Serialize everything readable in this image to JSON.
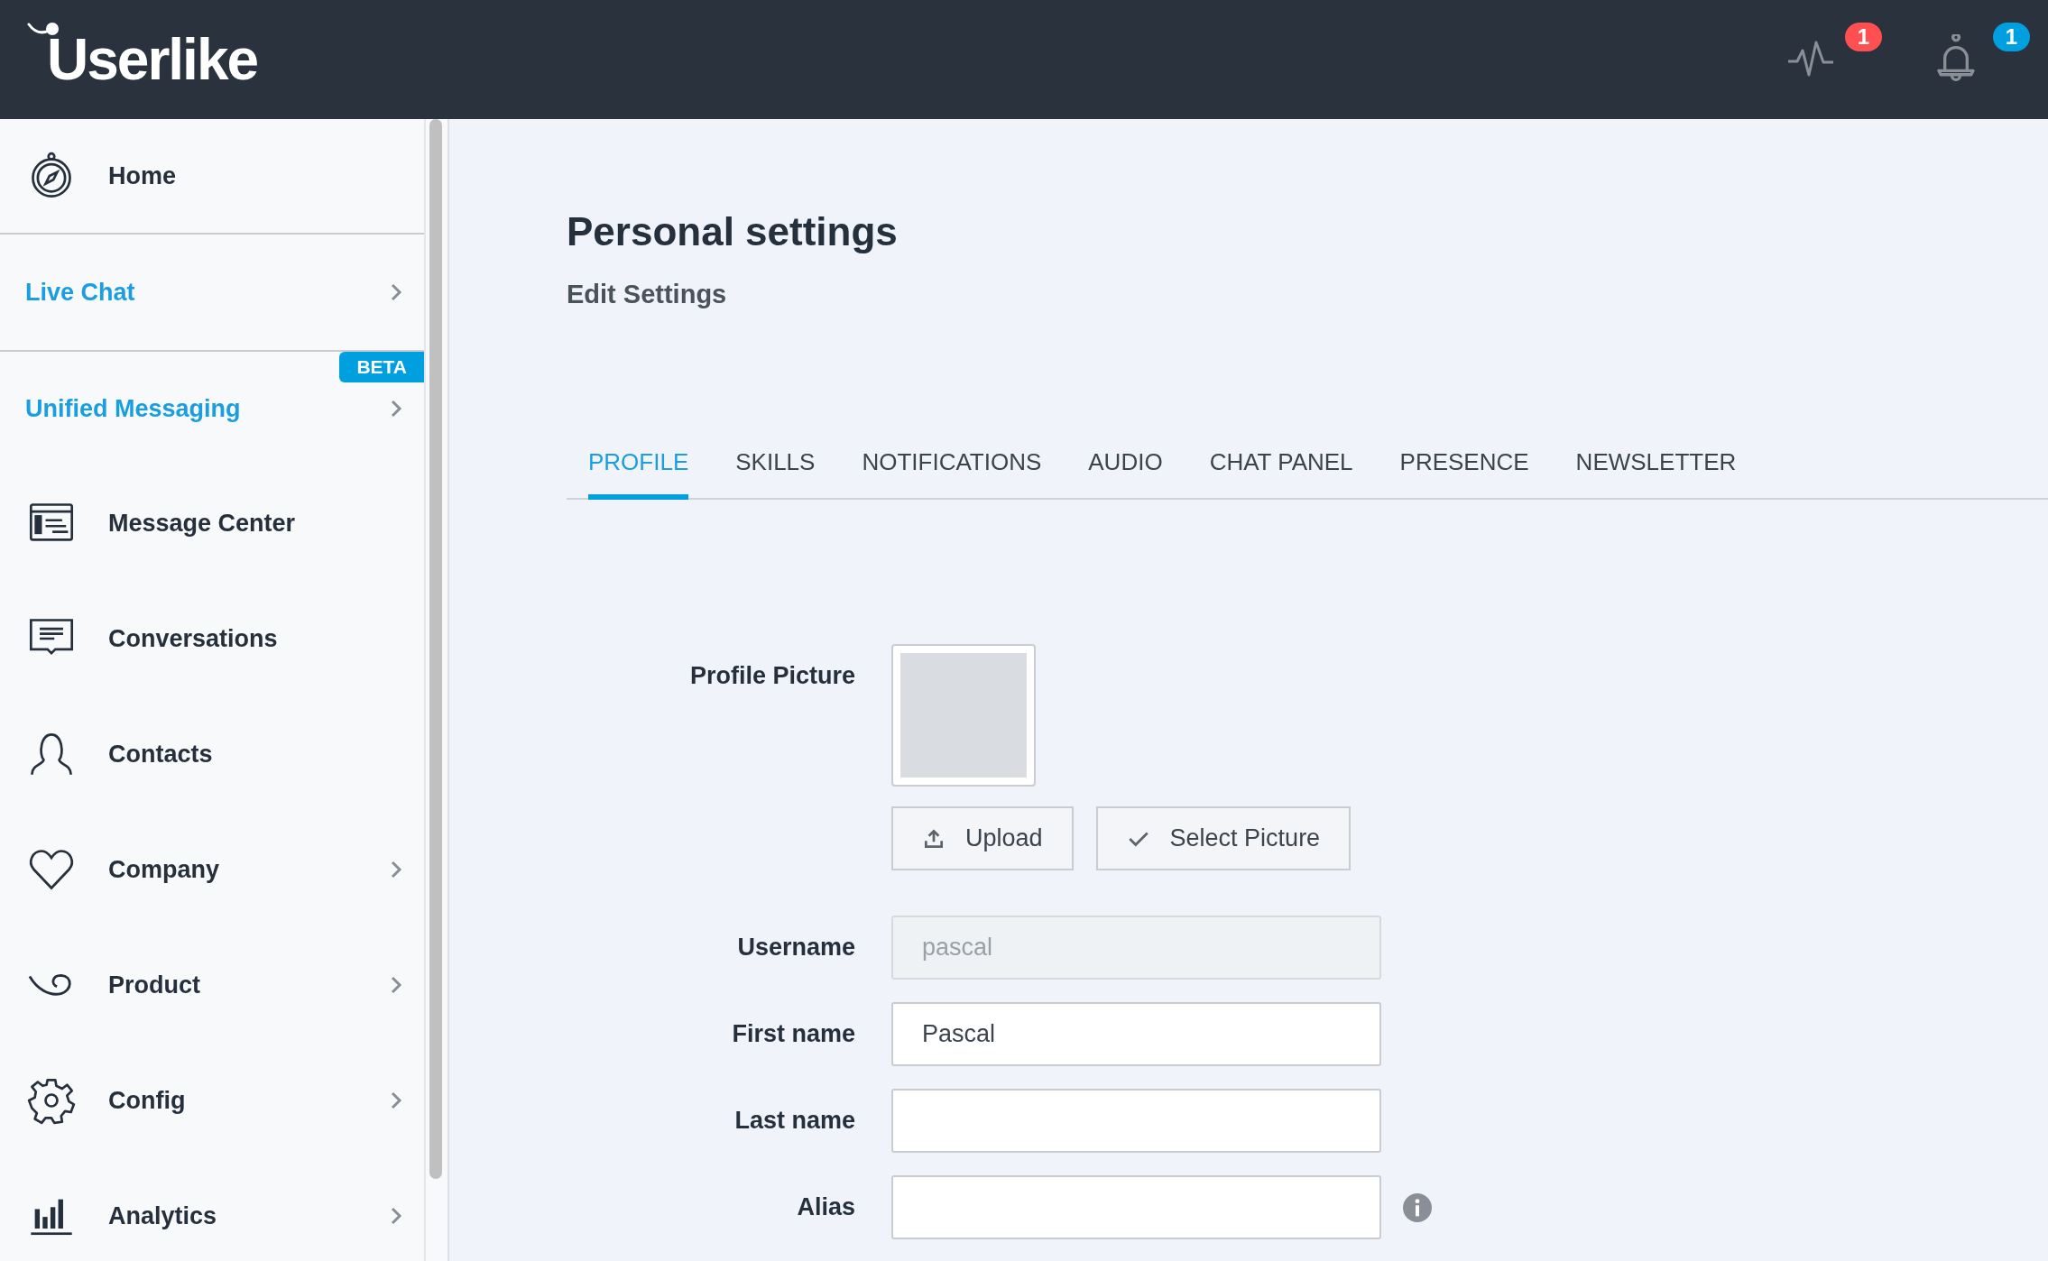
{
  "header": {
    "logo": "Userlike",
    "activity_badge": "1",
    "notification_badge": "1"
  },
  "sidebar": {
    "items": [
      {
        "label": "Home",
        "kind": "page",
        "has_submenu": false
      },
      {
        "label": "Live Chat",
        "kind": "section",
        "has_submenu": true
      },
      {
        "label": "Unified Messaging",
        "kind": "section",
        "has_submenu": true,
        "badge": "BETA"
      },
      {
        "label": "Message Center",
        "kind": "page",
        "has_submenu": false
      },
      {
        "label": "Conversations",
        "kind": "page",
        "has_submenu": false
      },
      {
        "label": "Contacts",
        "kind": "page",
        "has_submenu": false
      },
      {
        "label": "Company",
        "kind": "page",
        "has_submenu": true
      },
      {
        "label": "Product",
        "kind": "page",
        "has_submenu": true
      },
      {
        "label": "Config",
        "kind": "page",
        "has_submenu": true
      },
      {
        "label": "Analytics",
        "kind": "page",
        "has_submenu": true
      }
    ]
  },
  "page": {
    "title": "Personal settings",
    "subtitle": "Edit Settings"
  },
  "tabs": [
    {
      "label": "PROFILE",
      "selected": true
    },
    {
      "label": "SKILLS",
      "selected": false
    },
    {
      "label": "NOTIFICATIONS",
      "selected": false
    },
    {
      "label": "AUDIO",
      "selected": false
    },
    {
      "label": "CHAT PANEL",
      "selected": false
    },
    {
      "label": "PRESENCE",
      "selected": false
    },
    {
      "label": "NEWSLETTER",
      "selected": false
    }
  ],
  "profile_picture": {
    "label": "Profile Picture",
    "buttons": [
      {
        "label": "Upload",
        "kind": "upload"
      },
      {
        "label": "Select Picture",
        "kind": "select"
      }
    ]
  },
  "fields": [
    {
      "label": "Username",
      "value": "pascal",
      "disabled": true,
      "has_info": false
    },
    {
      "label": "First name",
      "value": "Pascal",
      "disabled": false,
      "has_info": false
    },
    {
      "label": "Last name",
      "disabled": false,
      "has_info": false
    },
    {
      "label": "Alias",
      "disabled": false,
      "has_info": true
    }
  ]
}
